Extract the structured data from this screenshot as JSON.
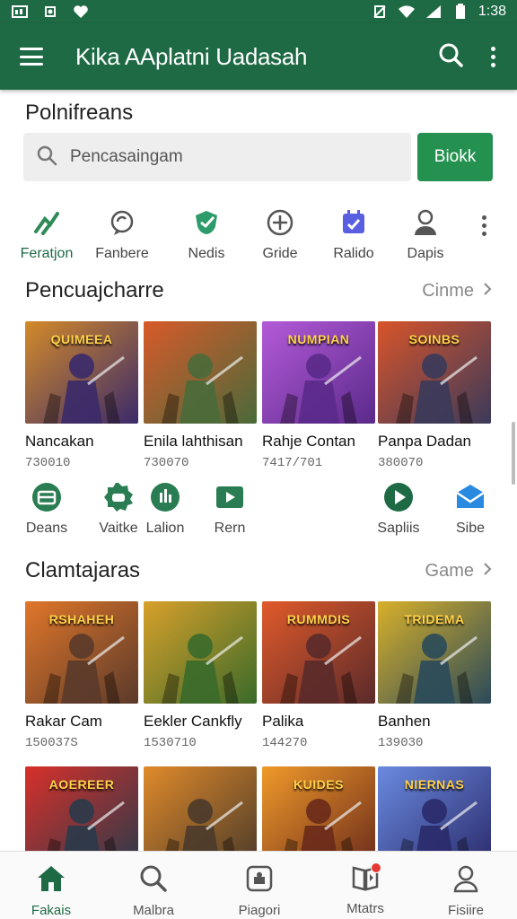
{
  "status": {
    "time": "1:38"
  },
  "appbar": {
    "title": "Kika AAplatni Uadasah"
  },
  "search": {
    "section_title": "Polnifreans",
    "placeholder": "Pencasaingam",
    "button_label": "Biokk"
  },
  "categories": [
    {
      "label": "Feratjon",
      "icon": "trend-icon",
      "color": "#2e8b57"
    },
    {
      "label": "Fanbere",
      "icon": "chat-icon",
      "color": "#555555"
    },
    {
      "label": "Nedis",
      "icon": "shield-check-icon",
      "color": "#2e9b6a"
    },
    {
      "label": "Gride",
      "icon": "plus-circle-icon",
      "color": "#555555"
    },
    {
      "label": "Ralido",
      "icon": "calendar-check-icon",
      "color": "#5a5ee0"
    },
    {
      "label": "Dapis",
      "icon": "person-icon",
      "color": "#555555"
    }
  ],
  "section1": {
    "title": "Pencuajcharre",
    "more_label": "Cinme",
    "cards": [
      {
        "name": "Nancakan",
        "sub": "730010",
        "thumb_title": "QUIMEEA",
        "bg": "#3a2a6a",
        "accent": "#d48a2a"
      },
      {
        "name": "Enila lahthisan",
        "sub": "730070",
        "thumb_title": "",
        "bg": "#4a6a3a",
        "accent": "#d85a2a"
      },
      {
        "name": "Rahje Contan",
        "sub": "7417/701",
        "thumb_title": "NUMPIAN",
        "bg": "#5a2a8a",
        "accent": "#b45ad8"
      },
      {
        "name": "Panpa Dadan",
        "sub": "380070",
        "thumb_title": "SOINBS",
        "bg": "#3a3a5a",
        "accent": "#d8542a"
      }
    ]
  },
  "quick_actions": [
    {
      "label": "Deans",
      "icon": "toolbox-icon"
    },
    {
      "label": "Vaitke",
      "icon": "gamepad-icon"
    },
    {
      "label": "Lalion",
      "icon": "bars-icon"
    },
    {
      "label": "Rern",
      "icon": "video-icon"
    },
    {
      "label": "Sapliis",
      "icon": "play-icon"
    },
    {
      "label": "Sibe",
      "icon": "mail-icon"
    }
  ],
  "section2": {
    "title": "Clamtajaras",
    "more_label": "Game",
    "cards": [
      {
        "name": "Rakar Cam",
        "sub": "150037S",
        "thumb_title": "RSHAHEH",
        "bg": "#5a3a2a",
        "accent": "#e0762a"
      },
      {
        "name": "Eekler Cankfly",
        "sub": "1530710",
        "thumb_title": "",
        "bg": "#3a6a2a",
        "accent": "#d8a02a"
      },
      {
        "name": "Palika",
        "sub": "144270",
        "thumb_title": "RUMMDIS",
        "bg": "#5a2a2a",
        "accent": "#e05a2a"
      },
      {
        "name": "Banhen",
        "sub": "139030",
        "thumb_title": "TRIDEMA",
        "bg": "#2a4a5a",
        "accent": "#d8b02a"
      }
    ]
  },
  "section3": {
    "cards": [
      {
        "thumb_title": "AOEREER",
        "bg": "#2a3a4a",
        "accent": "#d8302a"
      },
      {
        "thumb_title": "",
        "bg": "#4a3a2a",
        "accent": "#e08a2a"
      },
      {
        "thumb_title": "KUIDES",
        "bg": "#6a2a1a",
        "accent": "#f09a2a"
      },
      {
        "thumb_title": "NIERNAS",
        "bg": "#2a2a6a",
        "accent": "#6a8ae0"
      }
    ]
  },
  "bottom_nav": [
    {
      "label": "Fakais",
      "icon": "home-icon"
    },
    {
      "label": "Malbra",
      "icon": "search-icon"
    },
    {
      "label": "Piagori",
      "icon": "puzzle-icon"
    },
    {
      "label": "Mtatrs",
      "icon": "book-icon"
    },
    {
      "label": "Fisiire",
      "icon": "profile-icon"
    }
  ],
  "colors": {
    "primary": "#1e6a45",
    "button": "#249150",
    "badge": "#e53935"
  }
}
